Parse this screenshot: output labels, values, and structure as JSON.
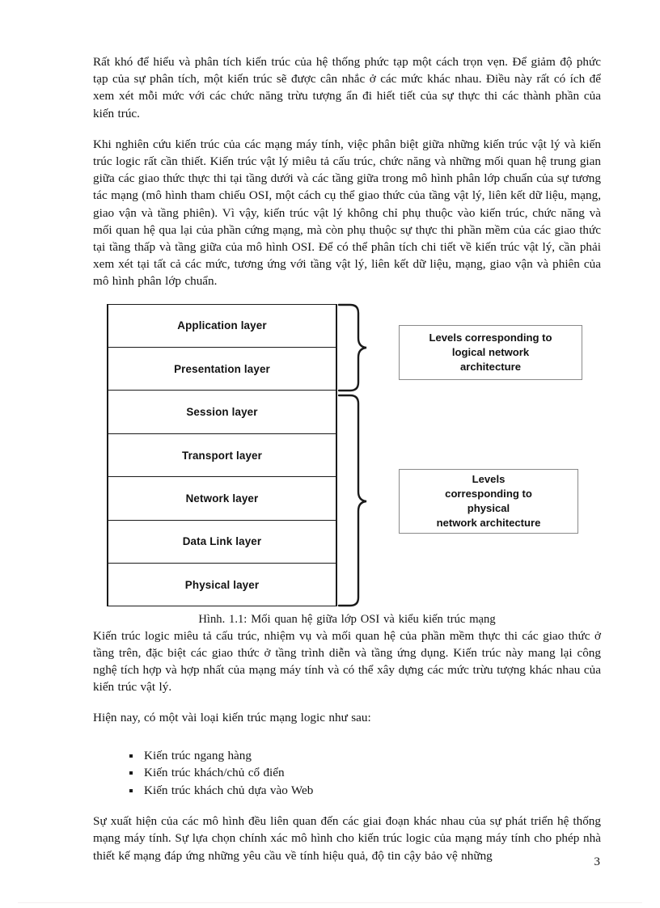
{
  "document": {
    "page_number": "3",
    "paragraphs": {
      "p1": "Rất khó để hiểu và phân tích kiến trúc của hệ thống phức tạp một cách trọn vẹn. Để giảm độ phức tạp của sự phân tích, một kiến trúc sẽ được cân nhắc ở các mức khác nhau. Điều này rất có ích để xem xét mỗi mức với các chức năng trừu tượng ẩn đi hiết tiết của sự thực thi các thành phần của kiến trúc.",
      "p2": "Khi nghiên cứu kiến trúc của các mạng máy tính, việc phân biệt giữa những kiến trúc vật lý và kiến trúc logic rất cần thiết. Kiến trúc vật lý miêu tả cấu trúc, chức năng và những mối quan hệ trung gian giữa các giao thức thực thi tại tầng dưới và các tầng giữa trong mô hình phân lớp chuẩn của sự tương tác mạng (mô hình tham chiếu OSI, một cách cụ thể giao thức của tầng vật lý, liên kết dữ liệu, mạng, giao vận và tầng phiên). Vì vậy, kiến trúc vật lý không chỉ phụ thuộc vào kiến trúc, chức năng và mối quan hệ qua lại của phần cứng mạng, mà còn phụ thuộc sự thực thi phần mềm của các giao thức tại tầng thấp và tầng giữa của mô hình OSI. Để có thể phân tích chi tiết về kiến trúc vật lý, cần phải xem xét tại tất cả các mức, tương ứng với tầng vật lý, liên kết dữ liệu, mạng, giao vận và phiên của mô hình phân lớp chuẩn.",
      "p3": "Kiến trúc logic miêu tả cấu trúc, nhiệm vụ và mối quan hệ của phần mềm thực thi các giao thức ở tầng trên, đặc biệt các giao thức ở tầng trình diễn và tầng ứng dụng. Kiến trúc này mang lại công nghệ tích hợp và hợp nhất của mạng máy tính và có thể xây dựng các mức trừu tượng khác nhau của kiến trúc vật lý.",
      "p4": "Hiện nay, có một vài loại kiến trúc mạng logic như sau:",
      "p5": "Sự xuất hiện của các mô hình đều liên quan đến các giai đoạn khác nhau của sự phát triển hệ thống mạng máy tính. Sự lựa chọn chính xác mô hình cho kiến trúc logic của mạng máy tính cho phép nhà thiết kế mạng đáp ứng những yêu cầu về tính hiệu quả, độ tin cậy bảo vệ những"
    },
    "bullets": [
      "Kiến trúc ngang hàng",
      "Kiến trúc khách/chủ cổ điển",
      "Kiến trúc khách chủ dựa vào Web"
    ],
    "figure": {
      "caption": "Hình. 1.1: Mối quan hệ giữa lớp OSI và kiểu kiến trúc mạng",
      "layers": [
        "Application layer",
        "Presentation layer",
        "Session layer",
        "Transport layer",
        "Network layer",
        "Data Link layer",
        "Physical layer"
      ],
      "callouts": {
        "logical": {
          "line1": "Levels corresponding to",
          "line2": "logical network",
          "line3": "architecture"
        },
        "physical": {
          "line1": "Levels",
          "line2": "corresponding to",
          "line3": "physical",
          "line4": "network architecture"
        }
      }
    },
    "colors": {
      "text": "#141414",
      "border": "#1a1a1a",
      "callout_border": "#8a8a8a",
      "background": "#ffffff"
    }
  }
}
